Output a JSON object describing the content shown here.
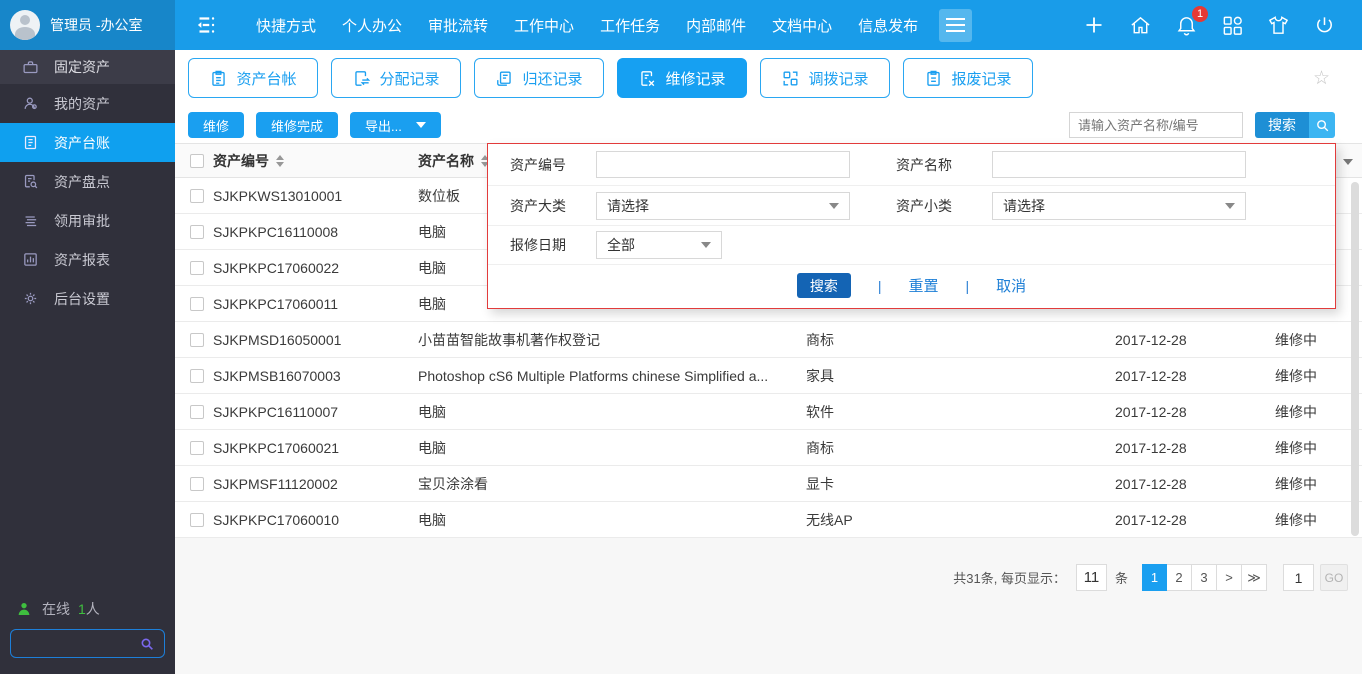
{
  "topbar": {
    "user_name": "管理员 -办公室",
    "nav_items": [
      "快捷方式",
      "个人办公",
      "审批流转",
      "工作中心",
      "工作任务",
      "内部邮件",
      "文档中心",
      "信息发布"
    ],
    "notification_count": "1"
  },
  "sidebar": {
    "section_header": "固定资产",
    "items": [
      {
        "label": "我的资产"
      },
      {
        "label": "资产台账"
      },
      {
        "label": "资产盘点"
      },
      {
        "label": "领用审批"
      },
      {
        "label": "资产报表"
      },
      {
        "label": "后台设置"
      }
    ],
    "online_label": "在线",
    "online_count": "1",
    "online_suffix": "人"
  },
  "tabs": [
    {
      "label": "资产台帐"
    },
    {
      "label": "分配记录"
    },
    {
      "label": "归还记录"
    },
    {
      "label": "维修记录"
    },
    {
      "label": "调拨记录"
    },
    {
      "label": "报废记录"
    }
  ],
  "toolbar": {
    "repair": "维修",
    "repair_done": "维修完成",
    "export": "导出...",
    "search_placeholder": "请输入资产名称/编号",
    "search_button": "搜索"
  },
  "filter_panel": {
    "asset_code_label": "资产编号",
    "asset_name_label": "资产名称",
    "asset_major_label": "资产大类",
    "asset_minor_label": "资产小类",
    "repair_date_label": "报修日期",
    "select_placeholder": "请选择",
    "date_value": "全部",
    "search": "搜索",
    "reset": "重置",
    "cancel": "取消"
  },
  "table": {
    "col_code": "资产编号",
    "col_name": "资产名称",
    "rows": [
      {
        "code": "SJKPKWS13010001",
        "name": "数位板",
        "category": "",
        "date": "",
        "status": ""
      },
      {
        "code": "SJKPKPC16110008",
        "name": "电脑",
        "category": "",
        "date": "",
        "status": ""
      },
      {
        "code": "SJKPKPC17060022",
        "name": "电脑",
        "category": "",
        "date": "",
        "status": ""
      },
      {
        "code": "SJKPKPC17060011",
        "name": "电脑",
        "category": "",
        "date": "",
        "status": ""
      },
      {
        "code": "SJKPMSD16050001",
        "name": "小苗苗智能故事机著作权登记",
        "category": "商标",
        "date": "2017-12-28",
        "status": "维修中"
      },
      {
        "code": "SJKPMSB16070003",
        "name": "Photoshop cS6 Multiple Platforms chinese Simplified a...",
        "category": "家具",
        "date": "2017-12-28",
        "status": "维修中"
      },
      {
        "code": "SJKPKPC16110007",
        "name": "电脑",
        "category": "软件",
        "date": "2017-12-28",
        "status": "维修中"
      },
      {
        "code": "SJKPKPC17060021",
        "name": "电脑",
        "category": "商标",
        "date": "2017-12-28",
        "status": "维修中"
      },
      {
        "code": "SJKPMSF11120002",
        "name": "宝贝涂涂看",
        "category": "显卡",
        "date": "2017-12-28",
        "status": "维修中"
      },
      {
        "code": "SJKPKPC17060010",
        "name": "电脑",
        "category": "无线AP",
        "date": "2017-12-28",
        "status": "维修中"
      }
    ]
  },
  "pagination": {
    "summary": "共31条, 每页显示：",
    "page_size": "11",
    "unit": "条",
    "page1": "1",
    "page2": "2",
    "page3": "3",
    "next": ">",
    "last": "≫",
    "goto_value": "1",
    "go": "GO"
  }
}
